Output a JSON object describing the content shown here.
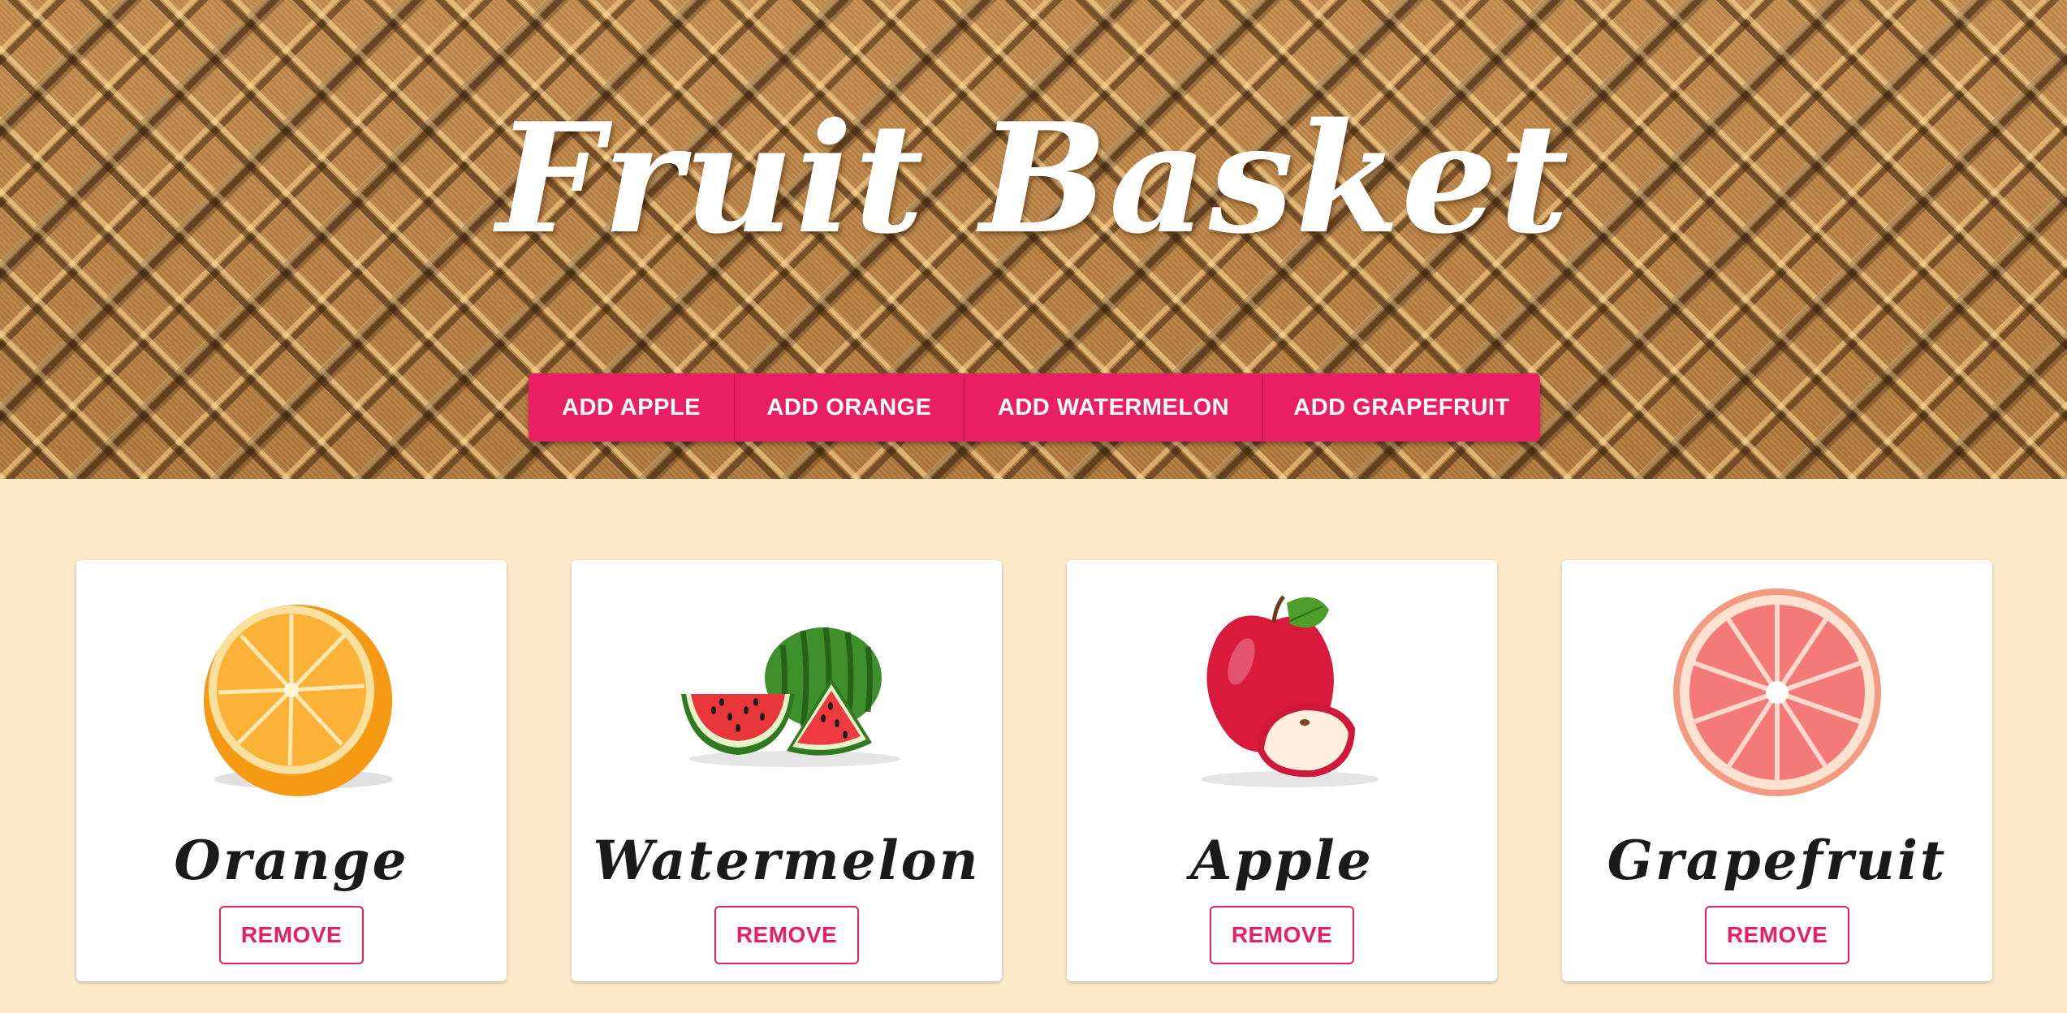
{
  "header": {
    "title": "Fruit Basket",
    "buttons": {
      "add_apple": "ADD APPLE",
      "add_orange": "ADD ORANGE",
      "add_watermelon": "ADD WATERMELON",
      "add_grapefruit": "ADD GRAPEFRUIT"
    }
  },
  "cards": [
    {
      "name": "Orange",
      "image": "orange-half-icon",
      "remove_label": "REMOVE"
    },
    {
      "name": "Watermelon",
      "image": "watermelon-slices-icon",
      "remove_label": "REMOVE"
    },
    {
      "name": "Apple",
      "image": "red-apple-icon",
      "remove_label": "REMOVE"
    },
    {
      "name": "Grapefruit",
      "image": "grapefruit-slice-icon",
      "remove_label": "REMOVE"
    }
  ],
  "colors": {
    "accent": "#e91e63",
    "page_background": "#fdeacb",
    "card_background": "#ffffff",
    "basket_brown": "#b98140"
  }
}
